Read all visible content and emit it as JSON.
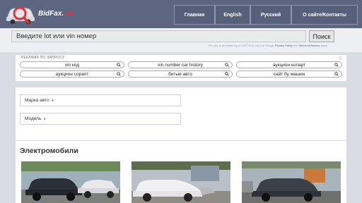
{
  "header": {
    "logo_text_main": "BidFax.",
    "logo_text_accent": "info",
    "nav": [
      {
        "label": "Главная"
      },
      {
        "label": "English"
      },
      {
        "label": "Русский"
      },
      {
        "label": "О сайте/Контакты"
      }
    ]
  },
  "search": {
    "placeholder": "Введите lot или vin номер",
    "button_label": "Поиск",
    "captcha_prefix": "This site is protected by reCAPTCHA and the Google ",
    "privacy_link": "Privacy Policy",
    "captcha_and": " and ",
    "terms_link": "Terms of Service",
    "captcha_suffix": " apply."
  },
  "ads": {
    "label": "РЕКЛАМА ПО ЗАПРОСУ",
    "adchoice_icon": "adchoices-icon",
    "pills": [
      {
        "label": "vin код"
      },
      {
        "label": "vin number car history"
      },
      {
        "label": "аукцион копарт"
      },
      {
        "label": "аукцион сорапт"
      },
      {
        "label": "битые авто"
      },
      {
        "label": "сайт бу машин"
      }
    ]
  },
  "filters": {
    "make_label": "Марка авто",
    "model_label": "Модель"
  },
  "section": {
    "title": "Электромобили"
  },
  "colors": {
    "header_bg": "#5d6681",
    "accent": "#e3333a",
    "page_bg": "#d9dce3"
  }
}
